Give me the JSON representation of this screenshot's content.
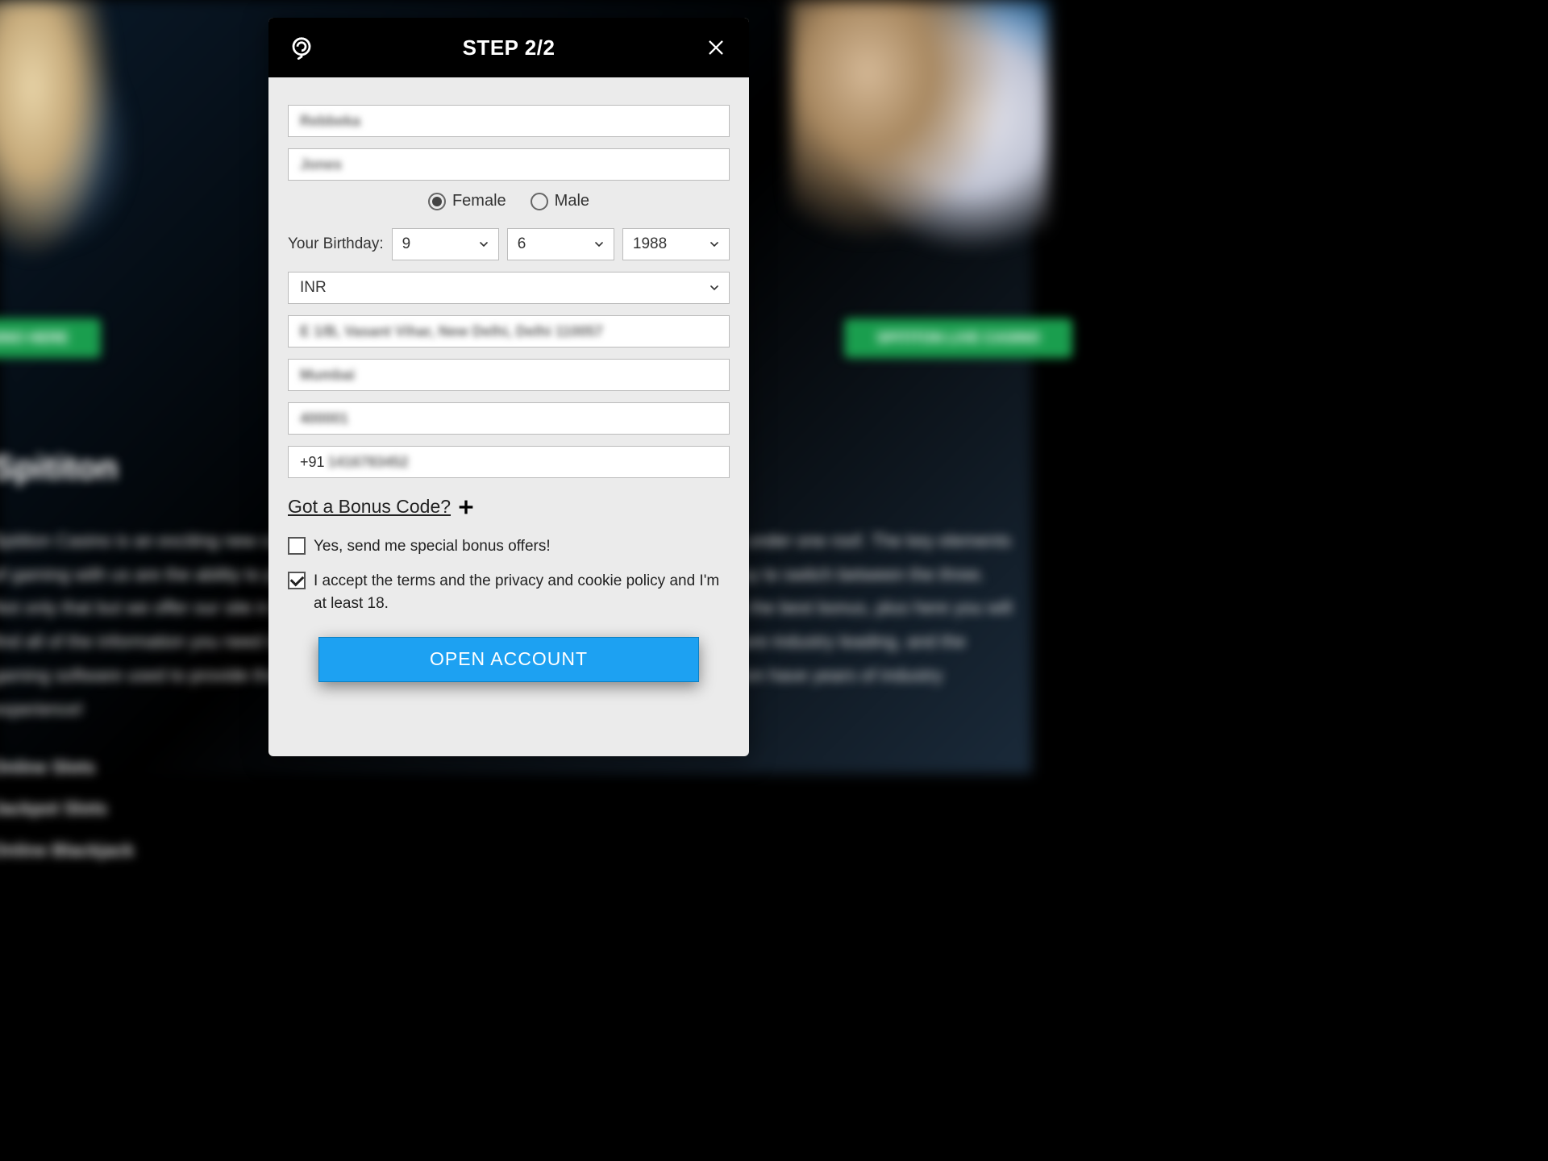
{
  "header": {
    "title": "STEP 2/2"
  },
  "form": {
    "first_name": "Rebbeka",
    "last_name": "Jones",
    "gender": {
      "female_label": "Female",
      "male_label": "Male",
      "selected": "female"
    },
    "birthday": {
      "label": "Your Birthday:",
      "day": "9",
      "month": "6",
      "year": "1988"
    },
    "currency": "INR",
    "address": "E 1/B, Vasant Vihar, New Delhi, Delhi 110057",
    "city": "Mumbai",
    "postal": "400001",
    "phone": {
      "prefix": "+91",
      "number": "1416783452"
    },
    "bonus_link": "Got a Bonus Code?",
    "special_offers": {
      "label": "Yes, send me special bonus offers!",
      "checked": false
    },
    "terms": {
      "label": "I accept the terms and the privacy and cookie policy and I'm at least 18.",
      "checked": true
    },
    "submit_label": "OPEN ACCOUNT"
  },
  "background": {
    "btn_left": "CASINO HERE",
    "btn_right": "SPITITON LIVE CASINO",
    "heading": "Spititon",
    "paragraph": "Spititon Casino is an exciting new casino and site that fills on everything an online gamer needs under one roof. The key elements of gaming with us are the ability to play slots, casino, and bet on the same platform making it easy to switch between the three. Not only that but we offer our site in eight different languages on a growing market. We offer you the best bonus, plus here you will find all of the information you need to get off to a great start of gambling. Services and software are industry leading, and the gaming software used to provide these services. It's hardly surprizing that the team behind Spititon have years of industry experience!",
    "list": [
      "Online Slots",
      "Jackpot Slots",
      "Online Blackjack"
    ]
  }
}
